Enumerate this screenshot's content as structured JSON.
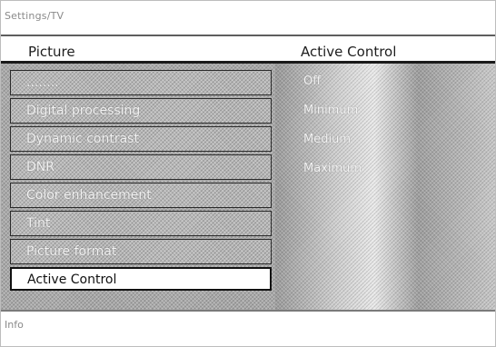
{
  "breadcrumb": "Settings/TV",
  "left_column_title": "Picture",
  "right_column_title": "Active Control",
  "menu_items": [
    {
      "label": "........"
    },
    {
      "label": "Digital processing"
    },
    {
      "label": "Dynamic contrast"
    },
    {
      "label": "DNR"
    },
    {
      "label": "Color enhancement"
    },
    {
      "label": "Tint"
    },
    {
      "label": "Picture format"
    },
    {
      "label": "Active Control"
    }
  ],
  "selected_menu_item": "Active Control",
  "options": [
    {
      "label": "Off"
    },
    {
      "label": "Minimum"
    },
    {
      "label": "Medium"
    },
    {
      "label": "Maximum"
    }
  ],
  "footer": {
    "info_label": "Info"
  }
}
